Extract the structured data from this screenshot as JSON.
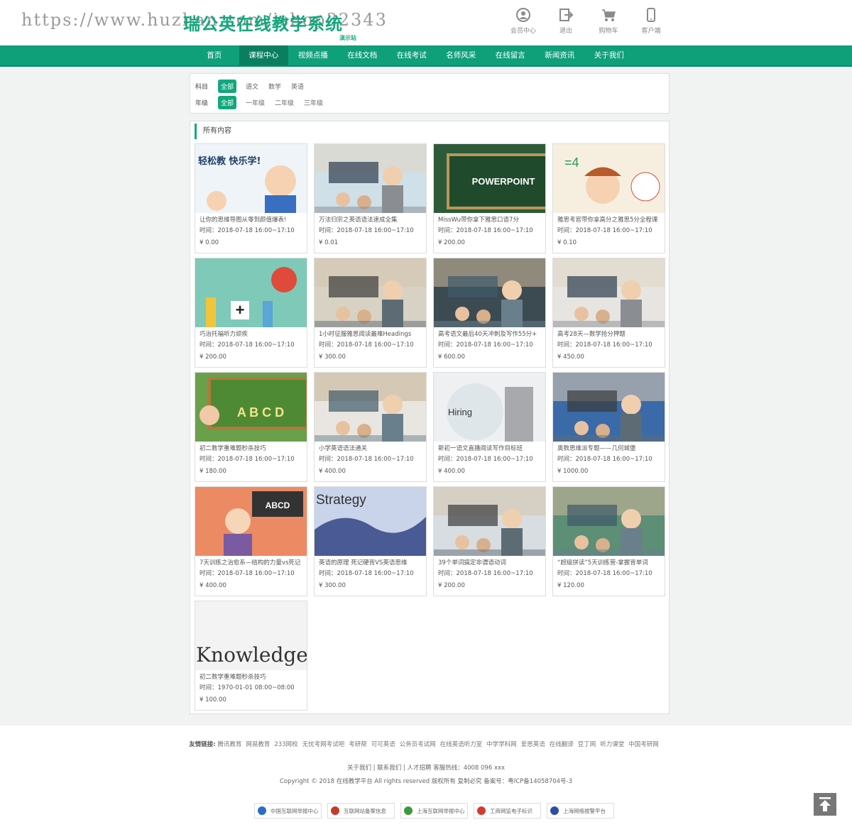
{
  "header": {
    "watermark": "https://www.huzhan.com/ishop32343",
    "logo": "瑞公英在线教学系统",
    "logo_sub": "演示站",
    "icons": [
      {
        "name": "member-icon",
        "label": "会员中心"
      },
      {
        "name": "logout-icon",
        "label": "退出"
      },
      {
        "name": "cart-icon",
        "label": "购物车"
      },
      {
        "name": "mobile-icon",
        "label": "客户端"
      }
    ]
  },
  "nav": [
    "首页",
    "课程中心",
    "视频点播",
    "在线文档",
    "在线考试",
    "名师风采",
    "在线留言",
    "新闻资讯",
    "关于我们"
  ],
  "nav_active": 1,
  "filter": {
    "subject_label": "科目",
    "subjects": [
      "全部",
      "语文",
      "数学",
      "英语"
    ],
    "grade_label": "年级",
    "grades": [
      "全部",
      "一年级",
      "二年级",
      "三年级"
    ]
  },
  "section_title": "所有内容",
  "courses": [
    {
      "title": "让你的思维导图从零到颜值爆表!",
      "time": "时间：2018-07-18 16:00~17:10",
      "price": "¥ 0.00",
      "img_text": "轻松教 快乐学!",
      "img_bg": "#eef4f8"
    },
    {
      "title": "万法归宗之英语语法速成全集",
      "time": "时间：2018-07-18 16:00~17:10",
      "price": "¥ 0.01",
      "img_text": "",
      "img_bg": "#cfe0e8"
    },
    {
      "title": "MissWu带你拿下雅思口语7分",
      "time": "时间：2018-07-18 16:00~17:10",
      "price": "¥ 200.00",
      "img_text": "POWERPOINT",
      "img_bg": "#2d5b3a"
    },
    {
      "title": "雅思考官带你拿高分之雅思5分全程课",
      "time": "时间：2018-07-18 16:00~17:10",
      "price": "¥ 0.10",
      "img_text": "=4",
      "img_bg": "#f6efe0"
    },
    {
      "title": "巧治托福听力顽疾",
      "time": "时间：2018-07-18 16:00~17:10",
      "price": "¥ 200.00",
      "img_text": "+",
      "img_bg": "#7fc9b8"
    },
    {
      "title": "1小时征服雅思阅读最难Headings",
      "time": "时间：2018-07-18 16:00~17:10",
      "price": "¥ 300.00",
      "img_text": "",
      "img_bg": "#d8d2c4"
    },
    {
      "title": "高考语文最后40天冲刺及写作55分+",
      "time": "时间：2018-07-18 16:00~17:10",
      "price": "¥ 600.00",
      "img_text": "",
      "img_bg": "#3c4a52"
    },
    {
      "title": "高考28天—数学抢分押题",
      "time": "时间：2018-07-18 16:00~17:10",
      "price": "¥ 450.00",
      "img_text": "",
      "img_bg": "#e7e5e2"
    },
    {
      "title": "初二数学重难题秒杀技巧",
      "time": "时间：2018-07-18 16:00~17:10",
      "price": "¥ 180.00",
      "img_text": "A B C D",
      "img_bg": "#6aa04a"
    },
    {
      "title": "小学英语语法通关",
      "time": "时间：2018-07-18 16:00~17:10",
      "price": "¥ 400.00",
      "img_text": "",
      "img_bg": "#e9e6e1"
    },
    {
      "title": "新初一语文直播阅读写作目标班",
      "time": "时间：2018-07-18 16:00~17:10",
      "price": "¥ 400.00",
      "img_text": "Hiring",
      "img_bg": "#eef0f1"
    },
    {
      "title": "奥数思维派专题——几何城堡",
      "time": "时间：2018-07-18 16:00~17:10",
      "price": "¥ 1000.00",
      "img_text": "",
      "img_bg": "#3b6aa8"
    },
    {
      "title": "7天训练之治愈系—结构的力量vs死记",
      "time": "时间：2018-07-18 16:00~17:10",
      "price": "¥ 400.00",
      "img_text": "ABCD",
      "img_bg": "#ec8a63"
    },
    {
      "title": "英语的原理 死记硬背VS英语思维",
      "time": "时间：2018-07-18 16:00~17:10",
      "price": "¥ 300.00",
      "img_text": "Strategy",
      "img_bg": "#5e6ea0"
    },
    {
      "title": "39个单词搞定非谓语动词",
      "time": "时间：2018-07-18 16:00~17:10",
      "price": "¥ 200.00",
      "img_text": "",
      "img_bg": "#d7dde0"
    },
    {
      "title": "“超级拼读”5天训练营-掌握背单词",
      "time": "时间：2018-07-18 16:00~17:10",
      "price": "¥ 120.00",
      "img_text": "",
      "img_bg": "#5d8e76"
    },
    {
      "title": "初二数学重难题秒杀技巧",
      "time": "时间：1970-01-01 08:00~08:00",
      "price": "¥ 100.00",
      "img_text": "Knowledge",
      "img_bg": "#f3f3f3"
    }
  ],
  "footer": {
    "links_label": "友情链接:",
    "links": [
      "腾讯教育",
      "网易教育",
      "233网校",
      "无忧考网考试吧",
      "考研帮",
      "可可英语",
      "公务员考试网",
      "在线英语听力室",
      "中学学科网",
      "爱思英语",
      "在线翻译",
      "豆丁网",
      "听力课堂",
      "中国考研网"
    ],
    "info": "关于我们 | 联系我们 | 人才招聘  客服热线：4008 096 xxx",
    "copyright": "Copyright © 2018 在线教学平台 All rights reserved 版权所有 复制必究 备案号：粤ICP备14058704号-3",
    "badges": [
      {
        "label": "中国互联网举报中心",
        "color": "#2b6cc4"
      },
      {
        "label": "互联网站备案信息",
        "color": "#c43b2b"
      },
      {
        "label": "上海互联网举报中心",
        "color": "#3b9a3b"
      },
      {
        "label": "工商网监电子标识",
        "color": "#d33b2b"
      },
      {
        "label": "上海网络报警平台",
        "color": "#2b4fa8"
      }
    ]
  }
}
